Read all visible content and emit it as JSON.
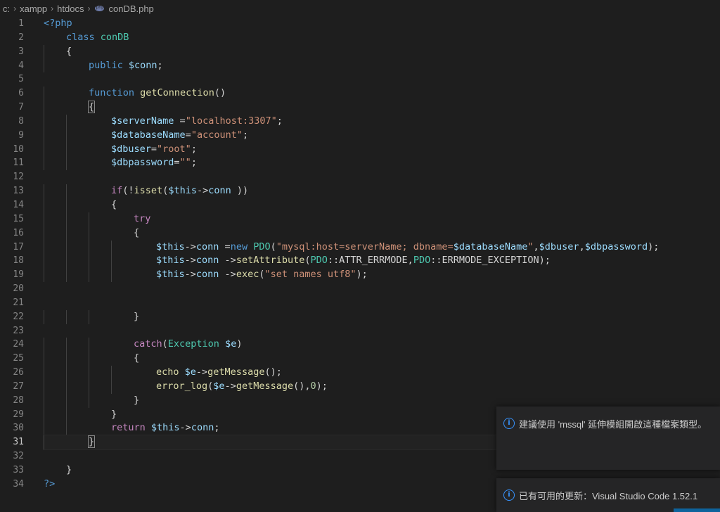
{
  "breadcrumb": {
    "drive": "c:",
    "folder1": "xampp",
    "folder2": "htdocs",
    "file": "conDB.php",
    "file_icon": "php-file-icon"
  },
  "editor": {
    "lines": [
      {
        "n": "1",
        "tokens": [
          [
            "t-tag",
            "<?php"
          ]
        ]
      },
      {
        "n": "2",
        "indent": 1,
        "tokens": [
          [
            "t-kw",
            "class "
          ],
          [
            "t-cls",
            "conDB"
          ]
        ]
      },
      {
        "n": "3",
        "indent": 1,
        "tokens": [
          [
            "t-op",
            "{"
          ]
        ]
      },
      {
        "n": "4",
        "indent": 2,
        "tokens": [
          [
            "t-kw",
            "public "
          ],
          [
            "t-var",
            "$conn"
          ],
          [
            "t-op",
            ";"
          ]
        ]
      },
      {
        "n": "5",
        "indent": 0,
        "tokens": []
      },
      {
        "n": "6",
        "indent": 2,
        "tokens": [
          [
            "t-kw",
            "function "
          ],
          [
            "t-fn",
            "getConnection"
          ],
          [
            "t-op",
            "()"
          ]
        ]
      },
      {
        "n": "7",
        "indent": 2,
        "tokens": [
          [
            "t-op bracket-box",
            "{"
          ]
        ]
      },
      {
        "n": "8",
        "indent": 3,
        "tokens": [
          [
            "t-var",
            "$serverName "
          ],
          [
            "t-op",
            "="
          ],
          [
            "t-str",
            "\"localhost:3307\""
          ],
          [
            "t-op",
            ";"
          ]
        ]
      },
      {
        "n": "9",
        "indent": 3,
        "tokens": [
          [
            "t-var",
            "$databaseName"
          ],
          [
            "t-op",
            "="
          ],
          [
            "t-str",
            "\"account\""
          ],
          [
            "t-op",
            ";"
          ]
        ]
      },
      {
        "n": "10",
        "indent": 3,
        "tokens": [
          [
            "t-var",
            "$dbuser"
          ],
          [
            "t-op",
            "="
          ],
          [
            "t-str",
            "\"root\""
          ],
          [
            "t-op",
            ";"
          ]
        ]
      },
      {
        "n": "11",
        "indent": 3,
        "tokens": [
          [
            "t-var",
            "$dbpassword"
          ],
          [
            "t-op",
            "="
          ],
          [
            "t-str",
            "\"\""
          ],
          [
            "t-op",
            ";"
          ]
        ]
      },
      {
        "n": "12",
        "indent": 0,
        "tokens": []
      },
      {
        "n": "13",
        "indent": 3,
        "tokens": [
          [
            "t-ctl",
            "if"
          ],
          [
            "t-op",
            "(!"
          ],
          [
            "t-fn",
            "isset"
          ],
          [
            "t-op",
            "("
          ],
          [
            "t-var",
            "$this"
          ],
          [
            "t-op",
            "->"
          ],
          [
            "t-var",
            "conn"
          ],
          [
            "t-op",
            " ))"
          ]
        ]
      },
      {
        "n": "14",
        "indent": 3,
        "tokens": [
          [
            "t-op",
            "{"
          ]
        ]
      },
      {
        "n": "15",
        "indent": 4,
        "tokens": [
          [
            "t-ctl",
            "try"
          ]
        ]
      },
      {
        "n": "16",
        "indent": 4,
        "tokens": [
          [
            "t-op",
            "{"
          ]
        ]
      },
      {
        "n": "17",
        "indent": 5,
        "tokens": [
          [
            "t-var",
            "$this"
          ],
          [
            "t-op",
            "->"
          ],
          [
            "t-var",
            "conn "
          ],
          [
            "t-op",
            "="
          ],
          [
            "t-kw",
            "new "
          ],
          [
            "t-cls",
            "PDO"
          ],
          [
            "t-op",
            "("
          ],
          [
            "t-str",
            "\"mysql:host=serverName; dbname="
          ],
          [
            "t-var",
            "$databaseName"
          ],
          [
            "t-str",
            "\""
          ],
          [
            "t-op",
            ","
          ],
          [
            "t-var",
            "$dbuser"
          ],
          [
            "t-op",
            ","
          ],
          [
            "t-var",
            "$dbpassword"
          ],
          [
            "t-op",
            ");"
          ]
        ]
      },
      {
        "n": "18",
        "indent": 5,
        "tokens": [
          [
            "t-var",
            "$this"
          ],
          [
            "t-op",
            "->"
          ],
          [
            "t-var",
            "conn "
          ],
          [
            "t-op",
            "->"
          ],
          [
            "t-fn",
            "setAttribute"
          ],
          [
            "t-op",
            "("
          ],
          [
            "t-cls",
            "PDO"
          ],
          [
            "t-op",
            "::ATTR_ERRMODE,"
          ],
          [
            "t-cls",
            "PDO"
          ],
          [
            "t-op",
            "::ERRMODE_EXCEPTION);"
          ]
        ]
      },
      {
        "n": "19",
        "indent": 5,
        "tokens": [
          [
            "t-var",
            "$this"
          ],
          [
            "t-op",
            "->"
          ],
          [
            "t-var",
            "conn "
          ],
          [
            "t-op",
            "->"
          ],
          [
            "t-fn",
            "exec"
          ],
          [
            "t-op",
            "("
          ],
          [
            "t-str",
            "\"set names utf8\""
          ],
          [
            "t-op",
            ");"
          ]
        ]
      },
      {
        "n": "20",
        "indent": 0,
        "tokens": []
      },
      {
        "n": "21",
        "indent": 0,
        "tokens": []
      },
      {
        "n": "22",
        "indent": 4,
        "tokens": [
          [
            "t-op",
            "}"
          ]
        ]
      },
      {
        "n": "23",
        "indent": 0,
        "tokens": []
      },
      {
        "n": "24",
        "indent": 4,
        "tokens": [
          [
            "t-ctl",
            "catch"
          ],
          [
            "t-op",
            "("
          ],
          [
            "t-cls",
            "Exception "
          ],
          [
            "t-var",
            "$e"
          ],
          [
            "t-op",
            ")"
          ]
        ]
      },
      {
        "n": "25",
        "indent": 4,
        "tokens": [
          [
            "t-op",
            "{"
          ]
        ]
      },
      {
        "n": "26",
        "indent": 5,
        "tokens": [
          [
            "t-fn",
            "echo "
          ],
          [
            "t-var",
            "$e"
          ],
          [
            "t-op",
            "->"
          ],
          [
            "t-fn",
            "getMessage"
          ],
          [
            "t-op",
            "();"
          ]
        ]
      },
      {
        "n": "27",
        "indent": 5,
        "tokens": [
          [
            "t-fn",
            "error_log"
          ],
          [
            "t-op",
            "("
          ],
          [
            "t-var",
            "$e"
          ],
          [
            "t-op",
            "->"
          ],
          [
            "t-fn",
            "getMessage"
          ],
          [
            "t-op",
            "(),"
          ],
          [
            "t-num",
            "0"
          ],
          [
            "t-op",
            ");"
          ]
        ]
      },
      {
        "n": "28",
        "indent": 4,
        "tokens": [
          [
            "t-op",
            "}"
          ]
        ]
      },
      {
        "n": "29",
        "indent": 3,
        "tokens": [
          [
            "t-op",
            "}"
          ]
        ]
      },
      {
        "n": "30",
        "indent": 3,
        "tokens": [
          [
            "t-ctl",
            "return "
          ],
          [
            "t-var",
            "$this"
          ],
          [
            "t-op",
            "->"
          ],
          [
            "t-var",
            "conn"
          ],
          [
            "t-op",
            ";"
          ]
        ]
      },
      {
        "n": "31",
        "indent": 2,
        "tokens": [
          [
            "t-op bracket-box",
            "}"
          ]
        ],
        "current": true
      },
      {
        "n": "32",
        "indent": 0,
        "tokens": []
      },
      {
        "n": "33",
        "indent": 1,
        "tokens": [
          [
            "t-op",
            "}"
          ]
        ]
      },
      {
        "n": "34",
        "indent": 0,
        "tokens": [
          [
            "t-tag",
            "?>"
          ]
        ]
      }
    ]
  },
  "notifications": [
    {
      "icon": "info-icon",
      "text": "建議使用 'mssql' 延伸模組開啟這種檔案類型。"
    },
    {
      "icon": "info-icon",
      "text": "已有可用的更新：Visual Studio Code 1.52.1"
    }
  ],
  "colors": {
    "background": "#1e1e1e",
    "keyword": "#569cd6",
    "control": "#c586c0",
    "variable": "#9cdcfe",
    "function": "#dcdcaa",
    "string": "#ce9178",
    "class": "#4ec9b0",
    "info": "#3794ff"
  }
}
